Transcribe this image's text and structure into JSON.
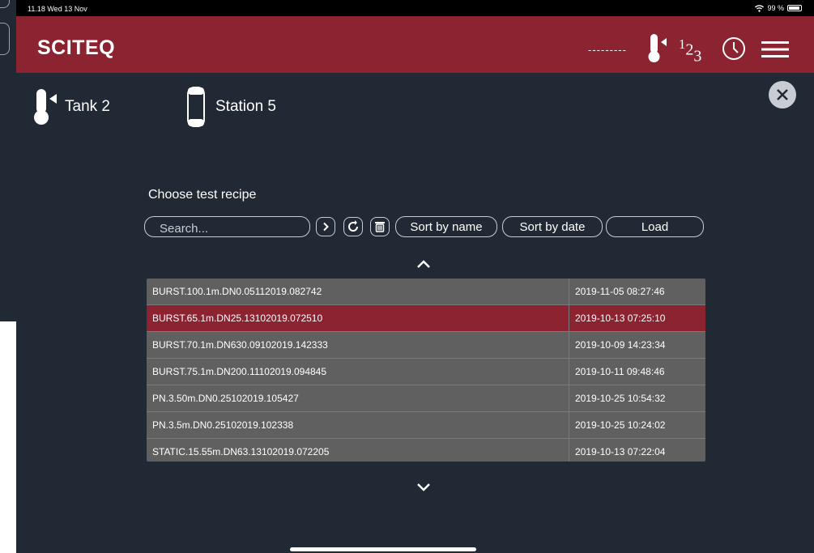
{
  "status": {
    "time": "11.18  Wed 13 Nov",
    "battery": "99 %"
  },
  "header": {
    "logo": "SCITEQ",
    "dashes": "---------",
    "counter_main": "1",
    "counter_sub": "2",
    "counter_sub2": "3"
  },
  "tank": {
    "label": "Tank 2"
  },
  "station": {
    "label": "Station 5"
  },
  "recipe": {
    "title": "Choose test recipe",
    "search_placeholder": "Search...",
    "sort_name": "Sort by name",
    "sort_date": "Sort by date",
    "load": "Load"
  },
  "rows": [
    {
      "name": "BURST.100.1m.DN0.05112019.082742",
      "date": "2019-11-05 08:27:46",
      "selected": false
    },
    {
      "name": "BURST.65.1m.DN25.13102019.072510",
      "date": "2019-10-13 07:25:10",
      "selected": true
    },
    {
      "name": "BURST.70.1m.DN630.09102019.142333",
      "date": "2019-10-09 14:23:34",
      "selected": false
    },
    {
      "name": "BURST.75.1m.DN200.11102019.094845",
      "date": "2019-10-11 09:48:46",
      "selected": false
    },
    {
      "name": "PN.3.50m.DN0.25102019.105427",
      "date": "2019-10-25 10:54:32",
      "selected": false
    },
    {
      "name": "PN.3.5m.DN0.25102019.102338",
      "date": "2019-10-25 10:24:02",
      "selected": false
    },
    {
      "name": "STATIC.15.55m.DN63.13102019.072205",
      "date": "2019-10-13 07:22:04",
      "selected": false
    }
  ],
  "colors": {
    "accent": "#8c2330",
    "background": "#212934",
    "table": "#606060"
  }
}
